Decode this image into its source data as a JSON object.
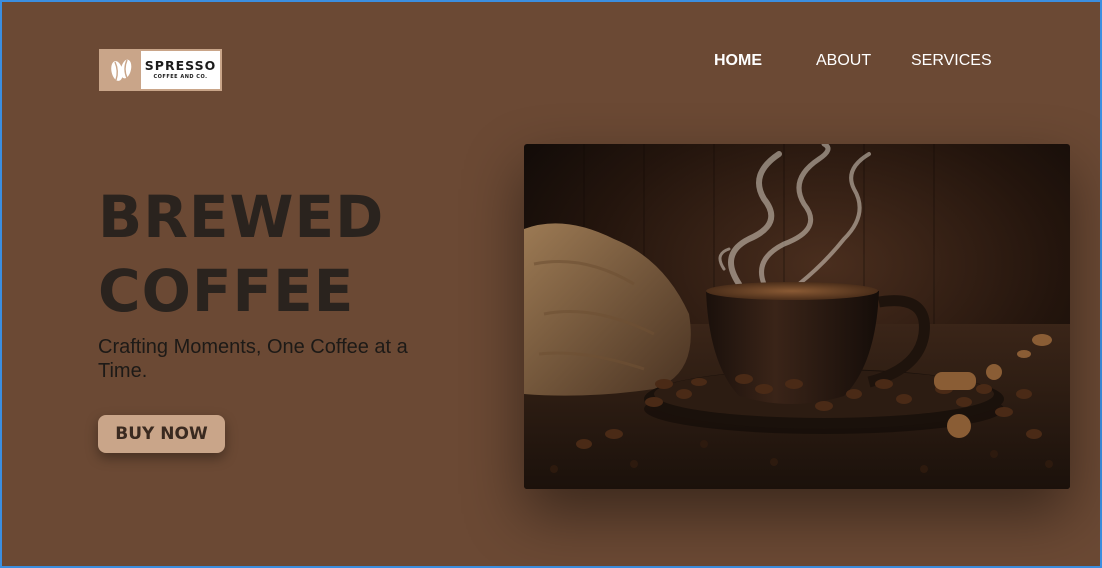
{
  "brand": {
    "name": "SPRESSO",
    "tagline": "COFFEE AND CO.",
    "logo_icon": "coffee-beans-icon",
    "accent_color": "#c9a589"
  },
  "nav": {
    "home": "HOME",
    "about": "ABOUT",
    "services": "SERVICES"
  },
  "hero": {
    "title_line1": "BREWED",
    "title_line2": "COFFEE",
    "subtitle": "Crafting Moments, One Coffee at a Time.",
    "cta_label": "BUY NOW",
    "image_subject": "steaming coffee cup on saucer with coffee beans"
  },
  "colors": {
    "background": "#6b4934",
    "button": "#c9a589",
    "text_dark": "#2a231e"
  }
}
